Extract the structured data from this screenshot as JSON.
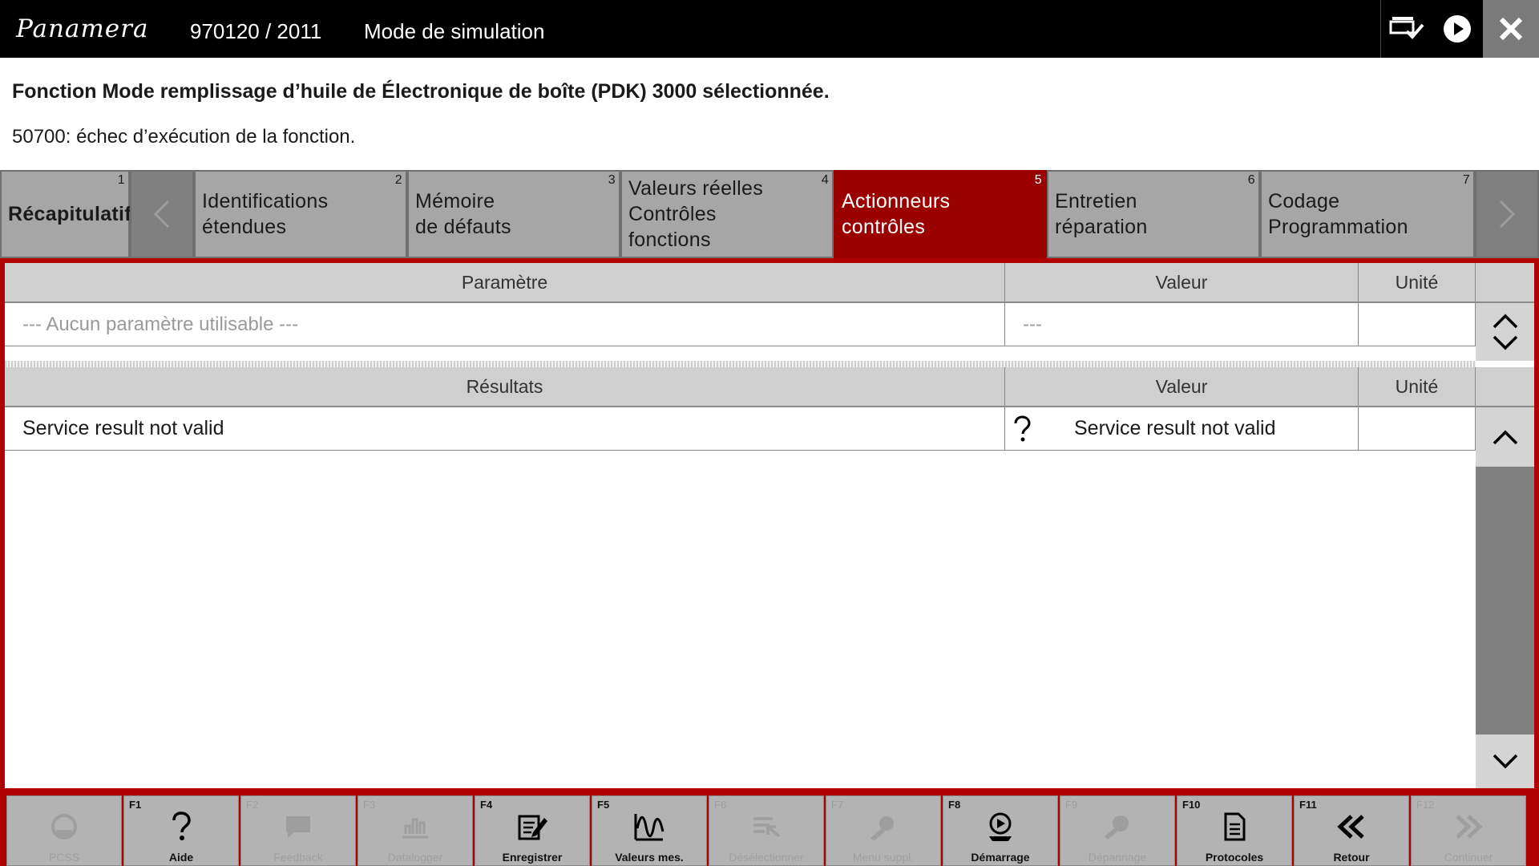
{
  "header": {
    "brand": "Panamera",
    "vehicle": "970120 / 2011",
    "mode": "Mode de simulation",
    "icons": [
      "update-check-icon",
      "play-icon",
      "close-icon"
    ]
  },
  "message": {
    "title": "Fonction Mode remplissage d’huile de Électronique de boîte (PDK) 3000 sélectionnée.",
    "status": "50700: échec d’exécution de la fonction."
  },
  "tabs": [
    {
      "num": "1",
      "label": "Récapitulatif",
      "active": false
    },
    {
      "num": "2",
      "label": "Identifications\nétendues",
      "active": false
    },
    {
      "num": "3",
      "label": "Mémoire\nde défauts",
      "active": false
    },
    {
      "num": "4",
      "label": "Valeurs réelles\nContrôles\nfonctions",
      "active": false
    },
    {
      "num": "5",
      "label": "Actionneurs\ncontrôles",
      "active": true
    },
    {
      "num": "6",
      "label": "Entretien\nréparation",
      "active": false
    },
    {
      "num": "7",
      "label": "Codage\nProgrammation",
      "active": false
    }
  ],
  "params_table": {
    "headers": {
      "param": "Paramètre",
      "value": "Valeur",
      "unit": "Unité"
    },
    "row": {
      "param": "--- Aucun paramètre utilisable ---",
      "value": "---",
      "unit": ""
    }
  },
  "results_table": {
    "headers": {
      "result": "Résultats",
      "value": "Valeur",
      "unit": "Unité"
    },
    "row": {
      "result": "Service result not valid",
      "value": "Service result not valid",
      "unit": "",
      "status_icon": "question-icon"
    }
  },
  "function_keys": [
    {
      "key": "",
      "label": "PCSS",
      "enabled": false,
      "icon": "pcss-icon"
    },
    {
      "key": "F1",
      "label": "Aide",
      "enabled": true,
      "icon": "help-icon"
    },
    {
      "key": "F2",
      "label": "Feedback",
      "enabled": false,
      "icon": "feedback-icon"
    },
    {
      "key": "F3",
      "label": "Datalogger",
      "enabled": false,
      "icon": "datalogger-icon"
    },
    {
      "key": "F4",
      "label": "Enregistrer",
      "enabled": true,
      "icon": "save-icon"
    },
    {
      "key": "F5",
      "label": "Valeurs mes.",
      "enabled": true,
      "icon": "measurement-icon"
    },
    {
      "key": "F6",
      "label": "Désélectionner",
      "enabled": false,
      "icon": "deselect-icon"
    },
    {
      "key": "F7",
      "label": "Menu suppl.",
      "enabled": false,
      "icon": "extra-menu-icon"
    },
    {
      "key": "F8",
      "label": "Démarrage",
      "enabled": true,
      "icon": "start-icon"
    },
    {
      "key": "F9",
      "label": "Dépannage",
      "enabled": false,
      "icon": "troubleshoot-icon"
    },
    {
      "key": "F10",
      "label": "Protocoles",
      "enabled": true,
      "icon": "protocol-icon"
    },
    {
      "key": "F11",
      "label": "Retour",
      "enabled": true,
      "icon": "back-icon"
    },
    {
      "key": "F12",
      "label": "Continuer",
      "enabled": false,
      "icon": "continue-icon"
    }
  ],
  "colors": {
    "accent": "#b00000",
    "active_tab": "#9b0000",
    "tab": "#a6a6a6",
    "topbar": "#000000"
  }
}
